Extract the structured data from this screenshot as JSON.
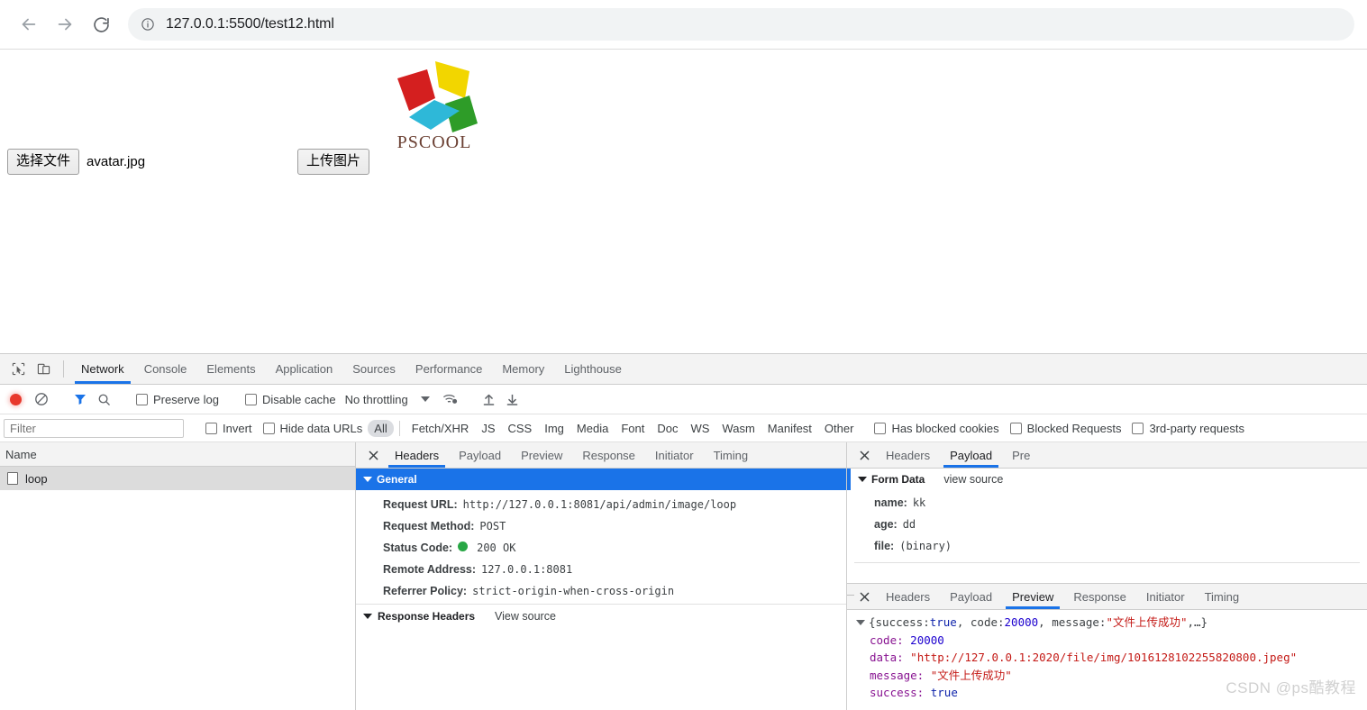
{
  "browser": {
    "back_icon": "arrow-left-icon",
    "forward_icon": "arrow-right-icon",
    "reload_icon": "reload-icon",
    "info_icon": "info-circle-icon",
    "url": "127.0.0.1:5500/test12.html"
  },
  "page": {
    "logo_text": "PSCOOL",
    "choose_file_label": "选择文件",
    "file_name": "avatar.jpg",
    "upload_label": "上传图片",
    "logo_colors": {
      "yellow": "#f2d600",
      "red": "#d41f1f",
      "green": "#2e9c28",
      "blue": "#2eb8d8",
      "text": "#6b4033"
    }
  },
  "devtools": {
    "inspect_icon": "cursor-select-icon",
    "device_toolbar_icon": "device-toggle-icon",
    "tabs": [
      {
        "label": "Network",
        "active": true
      },
      {
        "label": "Console",
        "active": false
      },
      {
        "label": "Elements",
        "active": false
      },
      {
        "label": "Application",
        "active": false
      },
      {
        "label": "Sources",
        "active": false
      },
      {
        "label": "Performance",
        "active": false
      },
      {
        "label": "Memory",
        "active": false
      },
      {
        "label": "Lighthouse",
        "active": false
      }
    ],
    "controls": {
      "record_icon": "record-stop-icon",
      "clear_icon": "clear-no-entry-icon",
      "filter_icon": "funnel-filter-icon",
      "search_icon": "search-magnifier-icon",
      "preserve_log_label": "Preserve log",
      "disable_cache_label": "Disable cache",
      "throttling_value": "No throttling",
      "caret_icon": "chevron-down-icon",
      "wifi_settings_icon": "network-conditions-icon",
      "import_icon": "import-har-up-arrow-icon",
      "export_icon": "export-har-down-arrow-icon"
    },
    "filter_bar": {
      "filter_placeholder": "Filter",
      "invert_label": "Invert",
      "hide_data_urls_label": "Hide data URLs",
      "types": [
        {
          "label": "All",
          "selected": true
        },
        {
          "label": "Fetch/XHR",
          "selected": false
        },
        {
          "label": "JS",
          "selected": false
        },
        {
          "label": "CSS",
          "selected": false
        },
        {
          "label": "Img",
          "selected": false
        },
        {
          "label": "Media",
          "selected": false
        },
        {
          "label": "Font",
          "selected": false
        },
        {
          "label": "Doc",
          "selected": false
        },
        {
          "label": "WS",
          "selected": false
        },
        {
          "label": "Wasm",
          "selected": false
        },
        {
          "label": "Manifest",
          "selected": false
        },
        {
          "label": "Other",
          "selected": false
        }
      ],
      "has_blocked_cookies_label": "Has blocked cookies",
      "blocked_requests_label": "Blocked Requests",
      "third_party_requests_label": "3rd-party requests"
    },
    "request_list": {
      "column_header": "Name",
      "rows": [
        {
          "name": "loop",
          "icon": "document-icon",
          "selected": true
        }
      ]
    },
    "detail_pane": {
      "close_icon": "close-x-icon",
      "tabs": [
        {
          "label": "Headers",
          "active": true
        },
        {
          "label": "Payload",
          "active": false
        },
        {
          "label": "Preview",
          "active": false
        },
        {
          "label": "Response",
          "active": false
        },
        {
          "label": "Initiator",
          "active": false
        },
        {
          "label": "Timing",
          "active": false
        }
      ],
      "general_section_title": "General",
      "general": [
        {
          "key": "Request URL:",
          "value": "http://127.0.0.1:8081/api/admin/image/loop"
        },
        {
          "key": "Request Method:",
          "value": "POST"
        },
        {
          "key": "Status Code:",
          "value": "200 OK",
          "status_dot": "#28a745"
        },
        {
          "key": "Remote Address:",
          "value": "127.0.0.1:8081"
        },
        {
          "key": "Referrer Policy:",
          "value": "strict-origin-when-cross-origin"
        }
      ],
      "response_headers_title": "Response Headers",
      "view_source_label": "View source"
    },
    "payload_pane": {
      "close_icon": "close-x-icon",
      "tabs": [
        {
          "label": "Headers",
          "active": false
        },
        {
          "label": "Payload",
          "active": true
        },
        {
          "label": "Pre",
          "active": false
        }
      ],
      "form_data_title": "Form Data",
      "view_source_label": "view source",
      "form_data": [
        {
          "key": "name:",
          "value": "kk"
        },
        {
          "key": "age:",
          "value": "dd"
        },
        {
          "key": "file:",
          "value": "(binary)"
        }
      ]
    },
    "preview_pane": {
      "close_icon": "close-x-icon",
      "tabs": [
        {
          "label": "Headers",
          "active": false
        },
        {
          "label": "Payload",
          "active": false
        },
        {
          "label": "Preview",
          "active": true
        },
        {
          "label": "Response",
          "active": false
        },
        {
          "label": "Initiator",
          "active": false
        },
        {
          "label": "Timing",
          "active": false
        }
      ],
      "summary_prefix": "{success: ",
      "summary_true": "true",
      "summary_mid1": ", code: ",
      "summary_code": "20000",
      "summary_mid2": ", message: ",
      "summary_message": "\"文件上传成功\"",
      "summary_suffix": ",…}",
      "entries": [
        {
          "key": "code:",
          "value": "20000",
          "kind": "num"
        },
        {
          "key": "data:",
          "value": "\"http://127.0.0.1:2020/file/img/1016128102255820800.jpeg\"",
          "kind": "str"
        },
        {
          "key": "message:",
          "value": "\"文件上传成功\"",
          "kind": "str"
        },
        {
          "key": "success:",
          "value": "true",
          "kind": "bool"
        }
      ]
    }
  },
  "watermark": "CSDN @ps酷教程"
}
